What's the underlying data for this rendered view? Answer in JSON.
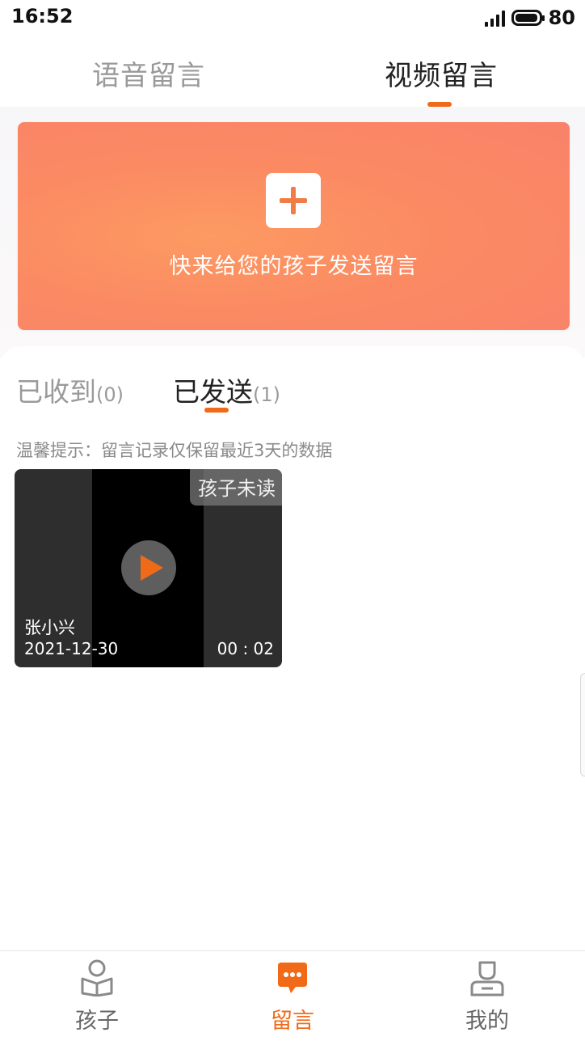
{
  "status_bar": {
    "time": "16:52",
    "battery_level": "80"
  },
  "top_tabs": [
    {
      "label": "语音留言",
      "active": false
    },
    {
      "label": "视频留言",
      "active": true
    }
  ],
  "banner": {
    "text": "快来给您的孩子发送留言"
  },
  "sub_tabs": [
    {
      "label": "已收到",
      "count": "(0)",
      "active": false
    },
    {
      "label": "已发送",
      "count": "(1)",
      "active": true
    }
  ],
  "tip": "温馨提示：留言记录仅保留最近3天的数据",
  "video_message": {
    "status": "孩子未读",
    "child_name": "张小兴",
    "date": "2021-12-30",
    "duration": "00 : 02"
  },
  "bottom_nav": [
    {
      "label": "孩子",
      "icon": "child-reading-icon",
      "active": false
    },
    {
      "label": "留言",
      "icon": "message-bubble-icon",
      "active": true
    },
    {
      "label": "我的",
      "icon": "person-icon",
      "active": false
    }
  ],
  "colors": {
    "accent": "#f06a18",
    "banner": "#fb8a63"
  }
}
